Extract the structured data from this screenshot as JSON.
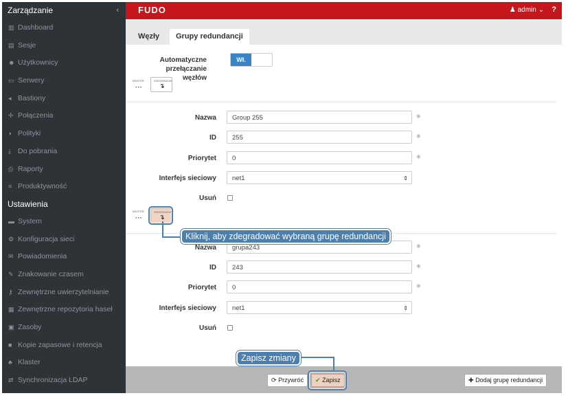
{
  "sidebar": {
    "title": "Zarządzanie",
    "items_top": [
      {
        "label": "Dashboard",
        "icon": "dashboard-icon",
        "glyph": "▥"
      },
      {
        "label": "Sesje",
        "icon": "sessions-icon",
        "glyph": "▤"
      },
      {
        "label": "Użytkownicy",
        "icon": "users-icon",
        "glyph": "☻"
      },
      {
        "label": "Serwery",
        "icon": "servers-icon",
        "glyph": "▭"
      },
      {
        "label": "Bastiony",
        "icon": "bastions-icon",
        "glyph": "◂"
      },
      {
        "label": "Połączenia",
        "icon": "connections-icon",
        "glyph": "✢"
      },
      {
        "label": "Polityki",
        "icon": "policies-icon",
        "glyph": "◗"
      },
      {
        "label": "Do pobrania",
        "icon": "download-icon",
        "glyph": "⤓"
      },
      {
        "label": "Raporty",
        "icon": "reports-icon",
        "glyph": "⎙"
      },
      {
        "label": "Produktywność",
        "icon": "productivity-icon",
        "glyph": "≡"
      }
    ],
    "section": "Ustawienia",
    "items_bottom": [
      {
        "label": "System",
        "icon": "system-icon",
        "glyph": "▬"
      },
      {
        "label": "Konfiguracja sieci",
        "icon": "network-icon",
        "glyph": "⚙"
      },
      {
        "label": "Powiadomienia",
        "icon": "notifications-icon",
        "glyph": "✉"
      },
      {
        "label": "Znakowanie czasem",
        "icon": "timestamp-icon",
        "glyph": "✎"
      },
      {
        "label": "Zewnętrzne uwierzytelnianie",
        "icon": "key-icon",
        "glyph": "⚷"
      },
      {
        "label": "Zewnętrzne repozytoria haseł",
        "icon": "repository-icon",
        "glyph": "▦"
      },
      {
        "label": "Zasoby",
        "icon": "resources-icon",
        "glyph": "▣"
      },
      {
        "label": "Kopie zapasowe i retencja",
        "icon": "backup-icon",
        "glyph": "■"
      },
      {
        "label": "Klaster",
        "icon": "cluster-icon",
        "glyph": "♣"
      },
      {
        "label": "Synchronizacja LDAP",
        "icon": "sync-icon",
        "glyph": "⇄"
      }
    ]
  },
  "topbar": {
    "logo": "FUDO",
    "user": "admin",
    "help": "?"
  },
  "tabs": [
    "Węzły",
    "Grupy redundancji"
  ],
  "auto_switch": {
    "label_line1": "Automatyczne przełączanie",
    "label_line2": "węzłów",
    "toggle_on": "Wł."
  },
  "node_diagram": {
    "master": "MASTER",
    "degraded": "ZDEGRADOW"
  },
  "groups": [
    {
      "name_label": "Nazwa",
      "name": "Group 255",
      "id_label": "ID",
      "id": "255",
      "priority_label": "Priorytet",
      "priority": "0",
      "iface_label": "Interfejs sieciowy",
      "iface": "net1",
      "delete_label": "Usuń"
    },
    {
      "name_label": "Nazwa",
      "name": "grupa243",
      "id_label": "ID",
      "id": "243",
      "priority_label": "Priorytet",
      "priority": "0",
      "iface_label": "Interfejs sieciowy",
      "iface": "net1",
      "delete_label": "Usuń"
    }
  ],
  "callouts": {
    "degrade": "Kliknij, aby zdegradować wybraną grupę redundancji",
    "save": "Zapisz zmiany"
  },
  "footer": {
    "revert": "Przywróć",
    "save": "Zapisz",
    "add_group": "Dodaj grupę redundancji"
  },
  "colors": {
    "brand_red": "#c4161c",
    "accent_blue": "#3a84c6",
    "callout_blue": "#4d7fae",
    "sidebar_bg": "#2e3338"
  }
}
